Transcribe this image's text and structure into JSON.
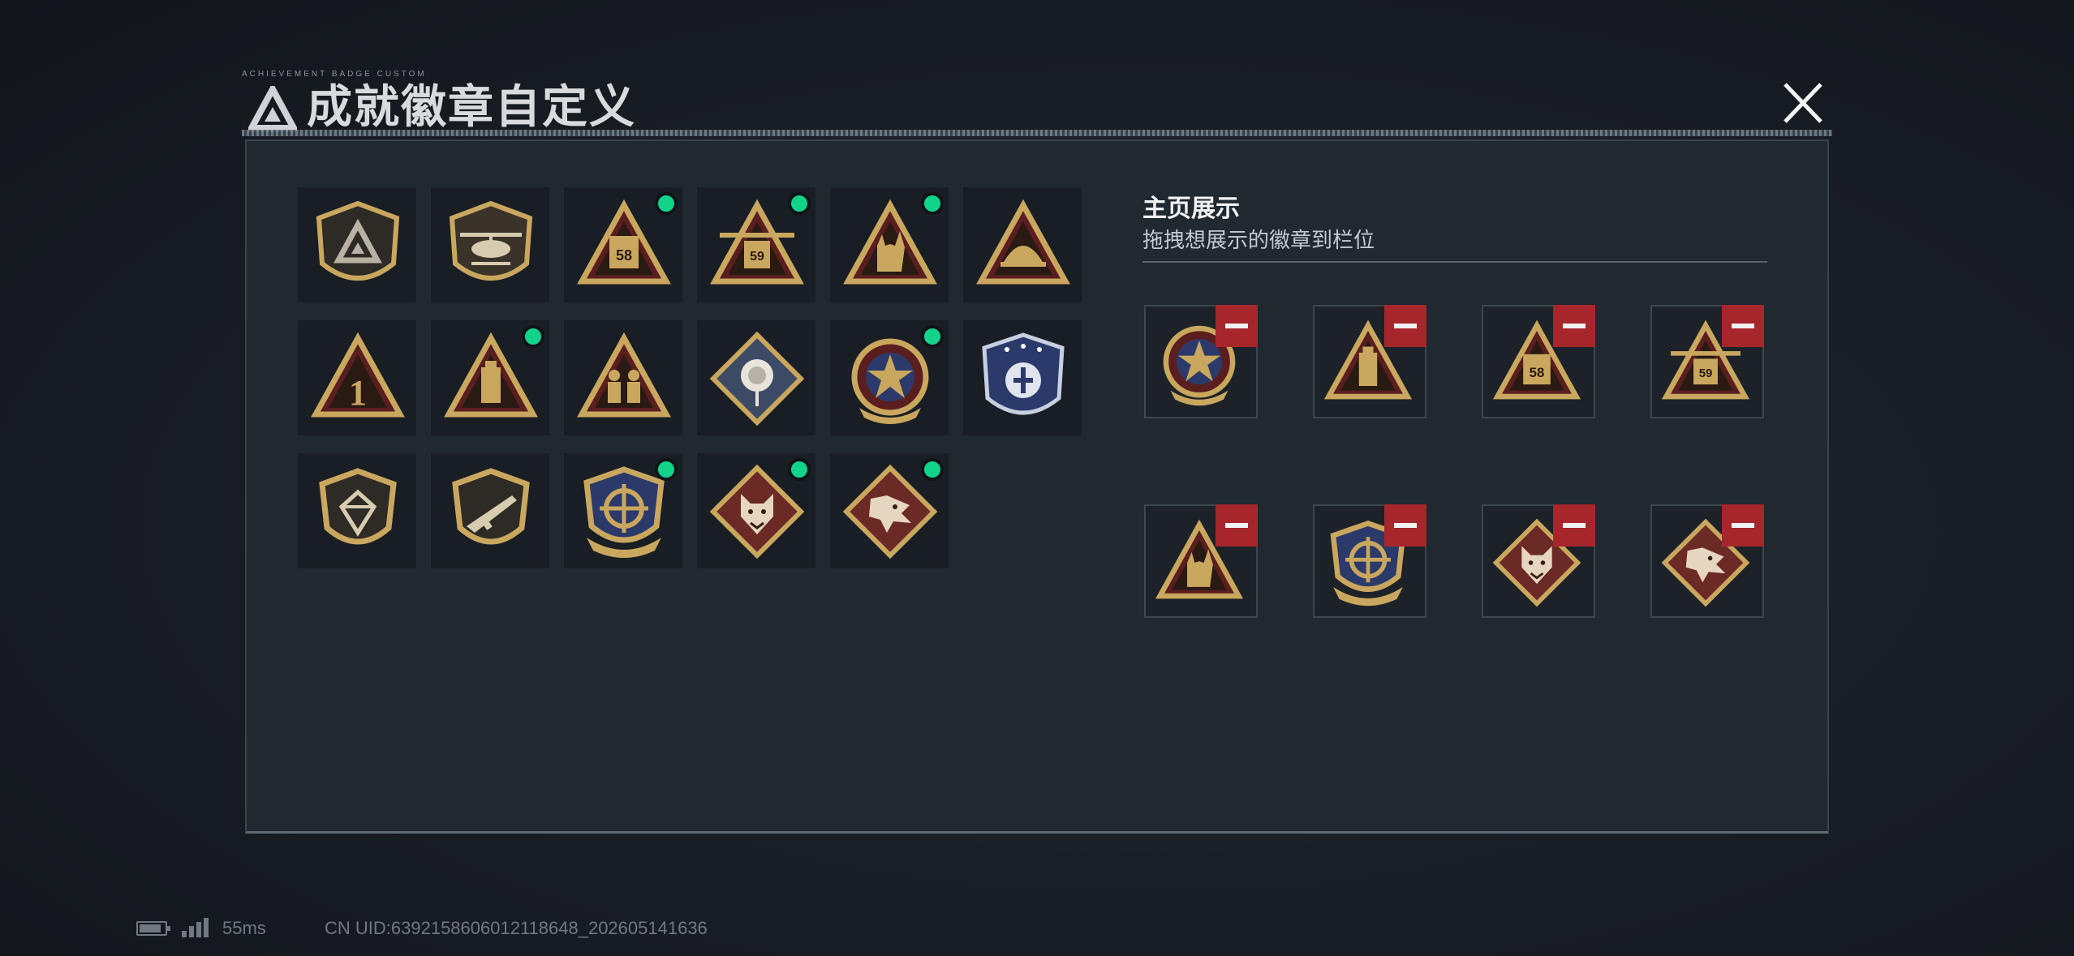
{
  "dialog": {
    "title": "成就徽章自定义",
    "title_small": "ACHIEVEMENT BADGE CUSTOM",
    "close_icon": "close-icon"
  },
  "badge_grid": [
    {
      "icon": "shield-triangle-badge",
      "new": false
    },
    {
      "icon": "helicopter-shield-badge",
      "new": false
    },
    {
      "icon": "radio-58-triangle-badge",
      "new": true
    },
    {
      "icon": "radio-59-winged-triangle-badge",
      "new": true
    },
    {
      "icon": "rock-hand-triangle-badge",
      "new": true
    },
    {
      "icon": "helmet-triangle-badge",
      "new": false
    },
    {
      "icon": "number-one-triangle-badge",
      "new": false
    },
    {
      "icon": "usb-drive-triangle-badge",
      "new": true
    },
    {
      "icon": "soldiers-triangle-badge",
      "new": false
    },
    {
      "icon": "rose-diamond-badge",
      "new": false
    },
    {
      "icon": "star-roundel-badge",
      "new": true
    },
    {
      "icon": "blue-eagle-shield-badge",
      "new": false
    },
    {
      "icon": "gem-shield-badge",
      "new": false
    },
    {
      "icon": "rifle-shield-badge",
      "new": false
    },
    {
      "icon": "crosshair-blue-shield-badge",
      "new": true
    },
    {
      "icon": "wolf-diamond-badge",
      "new": true
    },
    {
      "icon": "dragon-diamond-badge",
      "new": true
    }
  ],
  "display": {
    "title": "主页展示",
    "subtitle": "拖拽想展示的徽章到栏位",
    "slots": [
      {
        "icon": "star-roundel-badge"
      },
      {
        "icon": "usb-drive-triangle-badge"
      },
      {
        "icon": "radio-58-triangle-badge"
      },
      {
        "icon": "radio-59-winged-triangle-badge"
      },
      {
        "icon": "rock-hand-triangle-badge"
      },
      {
        "icon": "crosshair-blue-shield-badge"
      },
      {
        "icon": "wolf-diamond-badge"
      },
      {
        "icon": "dragon-diamond-badge"
      }
    ],
    "remove_icon": "minus-icon"
  },
  "status_bar": {
    "ping": "55ms",
    "uid": "CN UID:6392158606012118648_202605141636"
  },
  "colors": {
    "gold": "#c9a75e",
    "dark_red": "#5a1e1f",
    "new_dot": "#12d38a",
    "remove_red": "#a7262b",
    "navy": "#2b3a6b"
  }
}
